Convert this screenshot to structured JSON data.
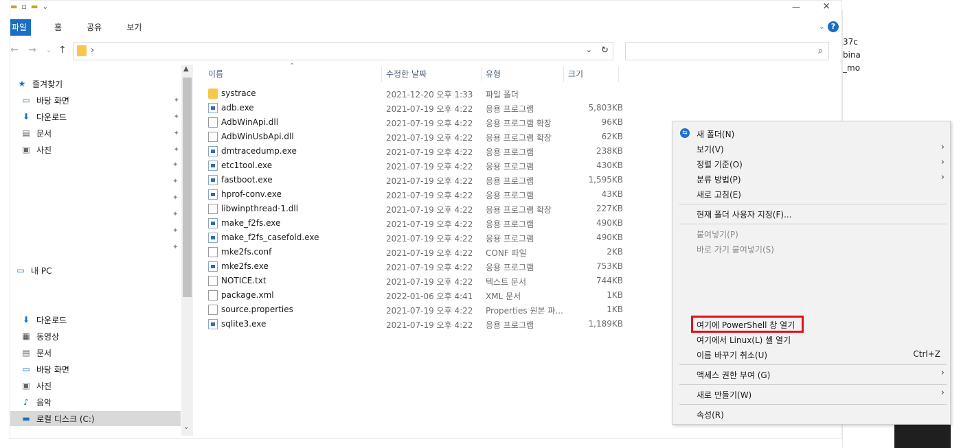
{
  "background": {
    "lines": [
      "37c",
      "bina",
      "_mo"
    ]
  },
  "ribbon": {
    "tabs": [
      "파일",
      "홈",
      "공유",
      "보기"
    ]
  },
  "addressbar": {
    "path_separator": "›"
  },
  "nav": {
    "quick_access": "즐겨찾기",
    "pinned": [
      {
        "label": "바탕 화면",
        "icon": "desktop-icon"
      },
      {
        "label": "다운로드",
        "icon": "download-icon"
      },
      {
        "label": "문서",
        "icon": "document-icon"
      },
      {
        "label": "사진",
        "icon": "pictures-icon"
      }
    ],
    "this_pc": "내 PC",
    "pc_items": [
      {
        "label": "다운로드",
        "icon": "download-icon"
      },
      {
        "label": "동영상",
        "icon": "video-icon"
      },
      {
        "label": "문서",
        "icon": "document-icon"
      },
      {
        "label": "바탕 화면",
        "icon": "desktop-icon"
      },
      {
        "label": "사진",
        "icon": "pictures-icon"
      },
      {
        "label": "음악",
        "icon": "music-icon"
      },
      {
        "label": "로컬 디스크 (C:)",
        "icon": "drive-icon"
      }
    ]
  },
  "columns": {
    "name": "이름",
    "date": "수정한 날짜",
    "type": "유형",
    "size": "크기"
  },
  "files": [
    {
      "name": "systrace",
      "date": "2021-12-20 오후 1:33",
      "type": "파일 폴더",
      "size": "",
      "kind": "folder"
    },
    {
      "name": "adb.exe",
      "date": "2021-07-19 오후 4:22",
      "type": "응용 프로그램",
      "size": "5,803KB",
      "kind": "exe"
    },
    {
      "name": "AdbWinApi.dll",
      "date": "2021-07-19 오후 4:22",
      "type": "응용 프로그램 확장",
      "size": "96KB",
      "kind": "dll"
    },
    {
      "name": "AdbWinUsbApi.dll",
      "date": "2021-07-19 오후 4:22",
      "type": "응용 프로그램 확장",
      "size": "62KB",
      "kind": "dll"
    },
    {
      "name": "dmtracedump.exe",
      "date": "2021-07-19 오후 4:22",
      "type": "응용 프로그램",
      "size": "238KB",
      "kind": "exe"
    },
    {
      "name": "etc1tool.exe",
      "date": "2021-07-19 오후 4:22",
      "type": "응용 프로그램",
      "size": "430KB",
      "kind": "exe"
    },
    {
      "name": "fastboot.exe",
      "date": "2021-07-19 오후 4:22",
      "type": "응용 프로그램",
      "size": "1,595KB",
      "kind": "exe"
    },
    {
      "name": "hprof-conv.exe",
      "date": "2021-07-19 오후 4:22",
      "type": "응용 프로그램",
      "size": "43KB",
      "kind": "exe"
    },
    {
      "name": "libwinpthread-1.dll",
      "date": "2021-07-19 오후 4:22",
      "type": "응용 프로그램 확장",
      "size": "227KB",
      "kind": "dll"
    },
    {
      "name": "make_f2fs.exe",
      "date": "2021-07-19 오후 4:22",
      "type": "응용 프로그램",
      "size": "490KB",
      "kind": "exe"
    },
    {
      "name": "make_f2fs_casefold.exe",
      "date": "2021-07-19 오후 4:22",
      "type": "응용 프로그램",
      "size": "490KB",
      "kind": "exe"
    },
    {
      "name": "mke2fs.conf",
      "date": "2021-07-19 오후 4:22",
      "type": "CONF 파일",
      "size": "2KB",
      "kind": "doc"
    },
    {
      "name": "mke2fs.exe",
      "date": "2021-07-19 오후 4:22",
      "type": "응용 프로그램",
      "size": "753KB",
      "kind": "exe"
    },
    {
      "name": "NOTICE.txt",
      "date": "2021-07-19 오후 4:22",
      "type": "텍스트 문서",
      "size": "744KB",
      "kind": "doc"
    },
    {
      "name": "package.xml",
      "date": "2022-01-06 오후 4:41",
      "type": "XML 문서",
      "size": "1KB",
      "kind": "doc"
    },
    {
      "name": "source.properties",
      "date": "2021-07-19 오후 4:22",
      "type": "Properties 원본 파...",
      "size": "1KB",
      "kind": "doc"
    },
    {
      "name": "sqlite3.exe",
      "date": "2021-07-19 오후 4:22",
      "type": "응용 프로그램",
      "size": "1,189KB",
      "kind": "exe"
    }
  ],
  "context_menu": {
    "new_folder": "새 폴더(N)",
    "view": "보기(V)",
    "sort_by": "정렬 기준(O)",
    "group_by": "분류 방법(P)",
    "refresh": "새로 고침(E)",
    "customize": "현재 폴더 사용자 지정(F)...",
    "paste": "붙여넣기(P)",
    "paste_shortcut": "바로 가기 붙여넣기(S)",
    "powershell": "여기에 PowerShell 창 열기",
    "linux_shell": "여기에서 Linux(L) 셸 열기",
    "undo_rename": "이름 바꾸기 취소(U)",
    "undo_shortcut": "Ctrl+Z",
    "give_access": "액세스 권한 부여 (G)",
    "new": "새로 만들기(W)",
    "properties": "속성(R)",
    "highlight_color": "#e0101a"
  }
}
